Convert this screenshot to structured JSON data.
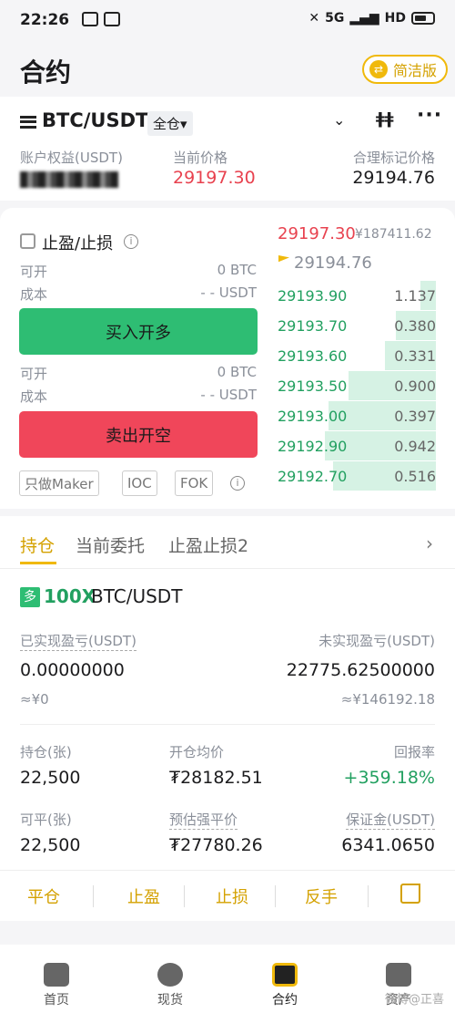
{
  "status": {
    "time": "22:26",
    "network": "5G",
    "hd": "HD"
  },
  "header": {
    "title": "合约",
    "simple_label": "简洁版"
  },
  "pairbar": {
    "pair": "BTC/USDT",
    "margin_mode": "全仓▾"
  },
  "account": {
    "equity_label": "账户权益(USDT)",
    "equity_value_hidden": "**,**7.447",
    "price_label": "当前价格",
    "price_value": "29197.30",
    "mark_label": "合理标记价格",
    "mark_value": "29194.76"
  },
  "order": {
    "tpsl_label": "止盈/止损",
    "open_label": "可开",
    "open_value": "0 BTC",
    "cost_label": "成本",
    "cost_value": "- - USDT",
    "buy_label": "买入开多",
    "sell_label": "卖出开空",
    "chips": [
      "只做Maker",
      "IOC",
      "FOK"
    ]
  },
  "book": {
    "last_price": "29197.30",
    "last_cny": "¥187411.62",
    "mark_price": "29194.76",
    "rows": [
      {
        "price": "29193.90",
        "qty": "1.137",
        "depth": 0.1
      },
      {
        "price": "29193.70",
        "qty": "0.380",
        "depth": 0.25
      },
      {
        "price": "29193.60",
        "qty": "0.331",
        "depth": 0.32
      },
      {
        "price": "29193.50",
        "qty": "0.900",
        "depth": 0.55
      },
      {
        "price": "29193.00",
        "qty": "0.397",
        "depth": 0.68
      },
      {
        "price": "29192.90",
        "qty": "0.942",
        "depth": 0.7
      },
      {
        "price": "29192.70",
        "qty": "0.516",
        "depth": 0.65
      }
    ]
  },
  "tabs": [
    "持仓",
    "当前委托",
    "止盈止损2"
  ],
  "position": {
    "side_badge": "多",
    "leverage": "100X",
    "pair": "BTC/USDT",
    "realized_label": "已实现盈亏(USDT)",
    "realized_value": "0.00000000",
    "realized_cny": "≈¥0",
    "unrealized_label": "未实现盈亏(USDT)",
    "unrealized_value": "22775.62500000",
    "unrealized_cny": "≈¥146192.18",
    "hold_label": "持仓(张)",
    "hold_value": "22,500",
    "avg_label": "开仓均价",
    "avg_value": "₮28182.51",
    "roe_label": "回报率",
    "roe_value": "+359.18%",
    "closable_label": "可平(张)",
    "closable_value": "22,500",
    "liq_label": "预估强平价",
    "liq_value": "₮27780.26",
    "margin_label": "保证金(USDT)",
    "margin_value": "6341.0650"
  },
  "actions": [
    "平仓",
    "止盈",
    "止损",
    "反手"
  ],
  "nav": [
    "首页",
    "现货",
    "合约",
    "资产"
  ],
  "watermark": "微博@正喜"
}
